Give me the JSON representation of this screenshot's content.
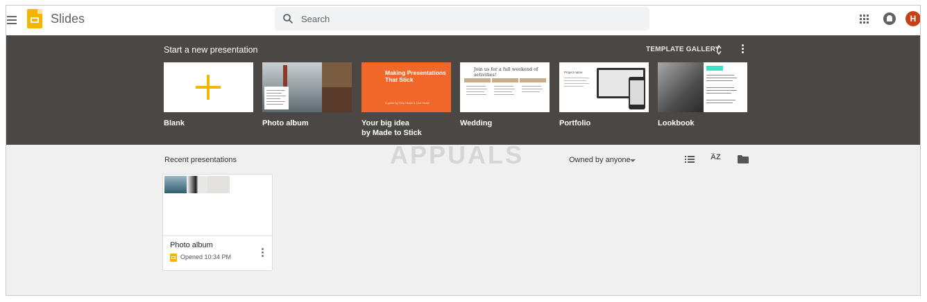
{
  "header": {
    "app_name": "Slides",
    "search_placeholder": "Search",
    "avatar_initial": "H"
  },
  "templates": {
    "section_title": "Start a new presentation",
    "gallery_label": "TEMPLATE GALLERY",
    "items": [
      {
        "label": "Blank"
      },
      {
        "label": "Photo album"
      },
      {
        "label": "Your big idea\nby Made to Stick",
        "thumb_title": "Making Presentations That Stick",
        "thumb_subtitle": "A guide by Chip Heath & Dan Heath"
      },
      {
        "label": "Wedding",
        "thumb_title": "Join us for a full weekend of activities!"
      },
      {
        "label": "Portfolio",
        "thumb_title": "Project name"
      },
      {
        "label": "Lookbook"
      }
    ]
  },
  "recent": {
    "section_title": "Recent presentations",
    "owner_filter": "Owned by anyone",
    "watermark": "APPUALS",
    "docs": [
      {
        "title": "Photo album",
        "meta": "Opened  10:34 PM"
      }
    ]
  },
  "colors": {
    "band": "#4b4744",
    "accent": "#f4b400",
    "orange": "#f2682a",
    "avatar": "#c4411a"
  }
}
